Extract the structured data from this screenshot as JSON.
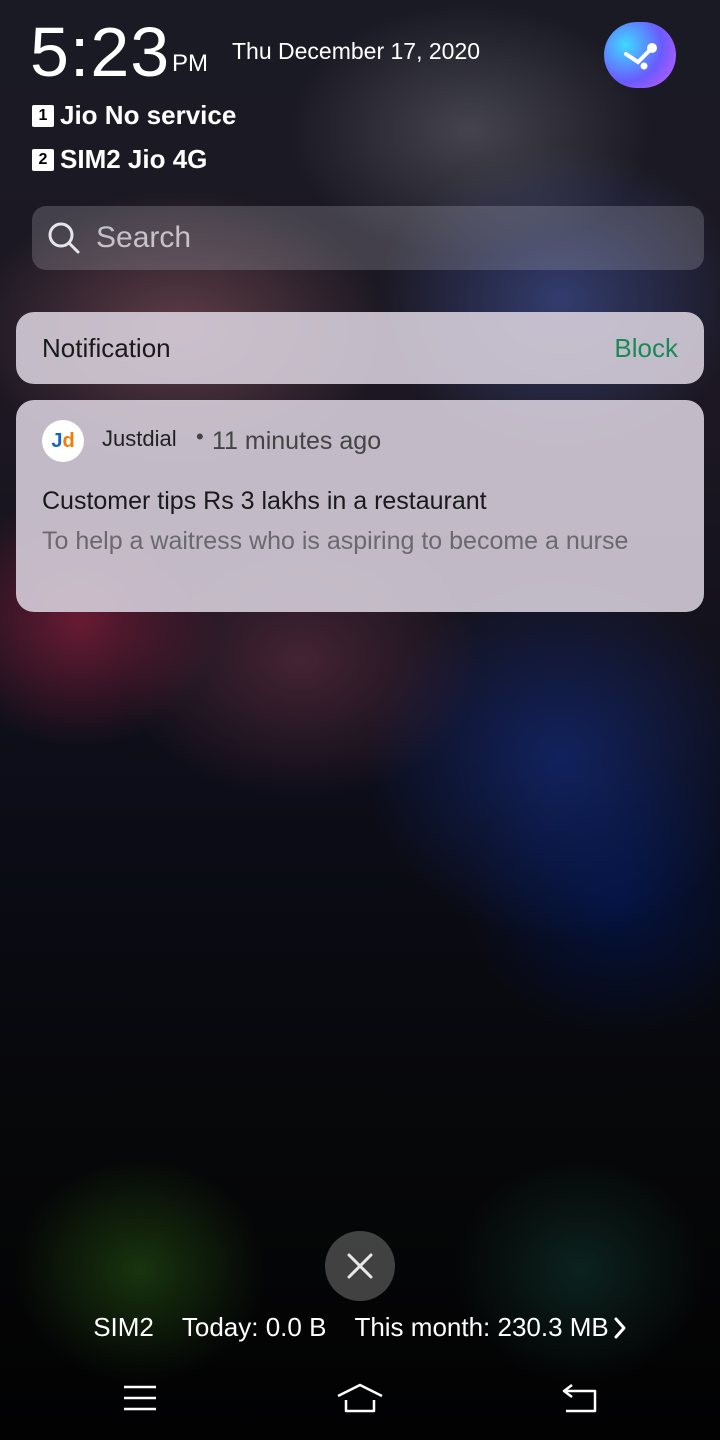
{
  "lockscreen": {
    "time": "5:23",
    "ampm": "PM",
    "date": "Thu December 17, 2020",
    "sims": [
      {
        "slot": "1",
        "label": "Jio No service"
      },
      {
        "slot": "2",
        "label": "SIM2 Jio 4G"
      }
    ]
  },
  "search": {
    "placeholder": "Search"
  },
  "notification_header": {
    "title": "Notification",
    "block_label": "Block"
  },
  "notification": {
    "app_name": "Justdial",
    "separator": "•",
    "time_ago": "11 minutes ago",
    "title": "Customer tips Rs 3 lakhs in a restaurant",
    "body": "To help a waitress who is aspiring to become a nurse",
    "logo_j": "J",
    "logo_d": "d"
  },
  "data_usage": {
    "sim": "SIM2",
    "today": "Today: 0.0 B",
    "month": "This month: 230.3 MB"
  },
  "icons": {
    "close": "close-icon",
    "menu": "menu-icon",
    "home": "home-icon",
    "back": "back-icon",
    "search": "search-icon",
    "chevron": "chevron-right-icon"
  },
  "colors": {
    "block": "#1a8a55",
    "card": "#dad2de"
  }
}
